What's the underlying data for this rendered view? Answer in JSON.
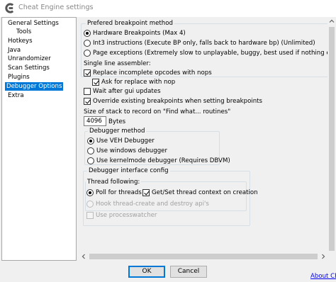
{
  "window": {
    "title": "Cheat Engine settings",
    "icon": "cheat-engine-logo-icon"
  },
  "tree": {
    "items": [
      {
        "label": "General Settings",
        "selected": false
      },
      {
        "label": "Tools",
        "selected": false
      },
      {
        "label": "Hotkeys",
        "selected": false
      },
      {
        "label": "Java",
        "selected": false
      },
      {
        "label": "Unrandomizer",
        "selected": false
      },
      {
        "label": "Scan Settings",
        "selected": false
      },
      {
        "label": "Plugins",
        "selected": false
      },
      {
        "label": "Debugger Options",
        "selected": true
      },
      {
        "label": "Extra",
        "selected": false
      }
    ]
  },
  "breakpoint_method": {
    "title": "Prefered breakpoint method",
    "options": [
      {
        "label": "Hardware Breakpoints (Max 4)",
        "selected": true
      },
      {
        "label": "Int3 instructions (Execute BP only, falls back to hardware bp) (Unlimited)",
        "selected": false
      },
      {
        "label": "Page exceptions (Extremely slow to unplayable, buggy, best used if nothing else works. D",
        "selected": false
      }
    ]
  },
  "assembler": {
    "label": "Single line assembler:",
    "replace_nops": {
      "label": "Replace incomplete opcodes with nops",
      "checked": true
    },
    "ask_replace": {
      "label": "Ask for replace with nop",
      "checked": true
    }
  },
  "wait_after_gui": {
    "label": "Wait after gui updates",
    "checked": false
  },
  "override_breakpoints": {
    "label": "Override existing breakpoints when setting breakpoints",
    "checked": true
  },
  "stack_size": {
    "label": "Size of stack to record on \"Find what... routines\"",
    "value": "4096",
    "unit": "Bytes"
  },
  "debugger_method": {
    "title": "Debugger method",
    "options": [
      {
        "label": "Use VEH Debugger",
        "selected": true
      },
      {
        "label": "Use windows debugger",
        "selected": false
      },
      {
        "label": "Use kernelmode debugger (Requires DBVM)",
        "selected": false
      }
    ]
  },
  "interface_config": {
    "title": "Debugger interface config",
    "thread_following": {
      "title": "Thread following:",
      "poll": {
        "label": "Poll for threads",
        "selected": true
      },
      "get_set_context": {
        "label": "Get/Set thread context on creation",
        "checked": true
      },
      "hook_thread": {
        "label": "Hook thread-create and destroy api's",
        "selected": false,
        "disabled": true
      }
    },
    "processwatcher": {
      "label": "Use processwatcher",
      "checked": false,
      "disabled": true
    }
  },
  "footer": {
    "ok_label": "OK",
    "cancel_label": "Cancel",
    "about_label": "About CE"
  },
  "colors": {
    "selection": "#0078d7",
    "link": "#0000ee",
    "group_border": "#d5dfe5"
  }
}
